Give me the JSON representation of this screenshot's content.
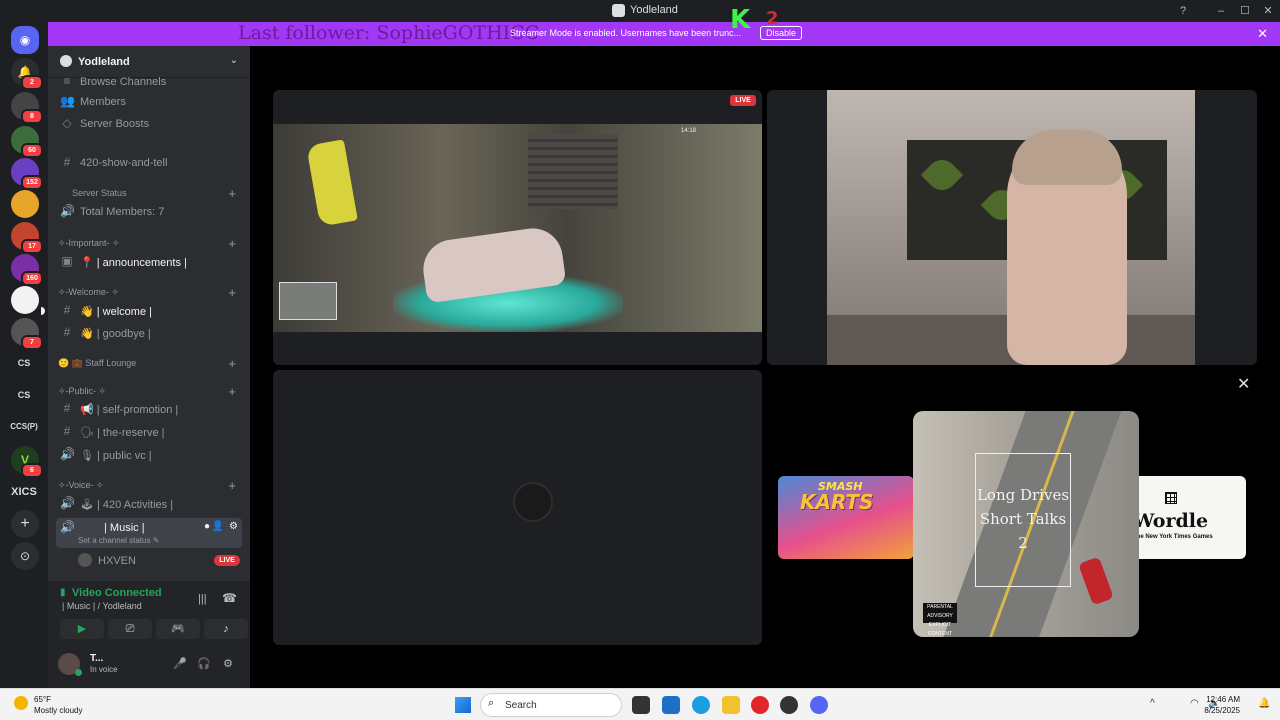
{
  "window": {
    "title": "Yodleland"
  },
  "overlay": {
    "last_follower": "Last follower: SophieGOTHICC",
    "streamer_notice": "Streamer Mode is enabled. Usernames have been trunc...",
    "disable_label": "Disable",
    "badge_letter": "K",
    "badge_number": "2"
  },
  "rail": {
    "badges": [
      "2",
      "8",
      "60",
      "152",
      "17",
      "160",
      "7",
      "6"
    ],
    "text_guilds": [
      "CS",
      "CS",
      "CCS(P)",
      "XICS"
    ]
  },
  "server": {
    "name": "Yodleland",
    "top_items": [
      "Browse Channels",
      "Members",
      "Server Boosts"
    ],
    "channels": {
      "show_and_tell": "420-show-and-tell",
      "server_status": "Server Status",
      "total_members": "Total Members: 7",
      "important": "✧-Important- ✧",
      "announcements": "📍 | announcements |",
      "welcome_cat": "✧-Welcome- ✧",
      "welcome": "👋 | welcome |",
      "goodbye": "👋 | goodbye |",
      "staff": "🙂 💼 Staff Lounge",
      "public": "✧-Public- ✧",
      "self_promotion": "📢 | self-promotion |",
      "the_reserve": "🗣 | the-reserve |",
      "public_vc": "🎙 | public vc |",
      "voice": "✧-Voice- ✧",
      "activities": "🕹 | 420 Activities |",
      "music": "| Music |",
      "channel_status": "Set a channel status ✎",
      "member": "HXVEN",
      "live": "LIVE"
    }
  },
  "voice": {
    "status": "Video Connected",
    "location": "| Music | / Yodleland"
  },
  "user": {
    "name": "T...",
    "status": "In voice"
  },
  "stream": {
    "live": "LIVE",
    "hud": "14:18"
  },
  "activities": {
    "left": {
      "line1": "SMASH",
      "line2": "KARTS"
    },
    "center": {
      "title_lines": [
        "Long Drives",
        "Short Talks",
        "2"
      ],
      "advisory": "PARENTAL ADVISORY EXPLICIT CONTENT"
    },
    "right": {
      "title": "Wordle",
      "sub": "The New York Times Games"
    }
  },
  "taskbar": {
    "temp": "65°F",
    "weather": "Mostly cloudy",
    "search": "Search",
    "time": "12:46 AM",
    "date": "8/25/2025"
  },
  "colors": {
    "accent": "#a237f5",
    "live": "#da373c",
    "connected": "#23a55a"
  }
}
